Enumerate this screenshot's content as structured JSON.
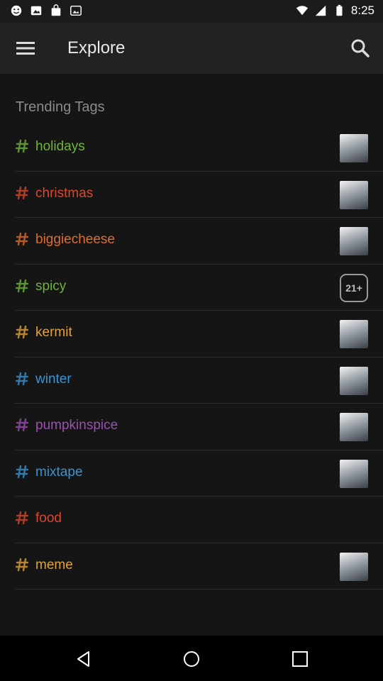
{
  "status": {
    "time": "8:25"
  },
  "appbar": {
    "title": "Explore",
    "menu_icon": "hamburger-menu-icon",
    "search_icon": "search-icon"
  },
  "section": {
    "title": "Trending Tags"
  },
  "tags": [
    {
      "label": "holidays",
      "color": "#6fb33a",
      "thumb": "image"
    },
    {
      "label": "christmas",
      "color": "#d8482f",
      "thumb": "image"
    },
    {
      "label": "biggiecheese",
      "color": "#e06c2f",
      "thumb": "image"
    },
    {
      "label": "spicy",
      "color": "#6fb33a",
      "thumb": "age-badge",
      "badge": "21+"
    },
    {
      "label": "kermit",
      "color": "#e0a33a",
      "thumb": "image"
    },
    {
      "label": "winter",
      "color": "#3b93cf",
      "thumb": "image"
    },
    {
      "label": "pumpkinspice",
      "color": "#9a4fb0",
      "thumb": "image"
    },
    {
      "label": "mixtape",
      "color": "#3b93cf",
      "thumb": "image"
    },
    {
      "label": "food",
      "color": "#d8482f",
      "thumb": "none"
    },
    {
      "label": "meme",
      "color": "#e0a33a",
      "thumb": "image"
    }
  ]
}
